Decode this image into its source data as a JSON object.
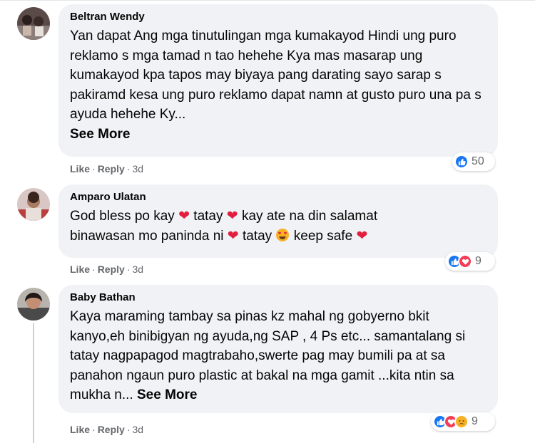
{
  "comments": [
    {
      "author": "Beltran Wendy",
      "text": "Yan dapat Ang mga tinutulingan mga kumakayod Hindi ung puro reklamo s mga tamad n tao hehehe Kya mas masarap ung kumakayod kpa tapos may biyaya pang darating sayo sarap s pakiramd kesa ung puro reklamo dapat namn at gusto puro una pa s ayuda hehehe Ky...",
      "see_more": "See More",
      "like": "Like",
      "reply": "Reply",
      "time": "3d",
      "reactions": [
        "like-icon"
      ],
      "reaction_count": "50"
    },
    {
      "author": "Amparo Ulatan",
      "text_parts": [
        "God bless po kay ",
        "heart",
        " tatay ",
        "heart",
        " kay ate na din salamat binawasan mo paninda ni ",
        "heart",
        " tatay ",
        "heart-eyes",
        " keep safe ",
        "heart"
      ],
      "text_segments": {
        "s1": "God bless po kay",
        "s2": "tatay",
        "s3": "kay ate na din salamat",
        "s4": "binawasan mo paninda ni",
        "s5": "tatay",
        "s6": "keep safe"
      },
      "like": "Like",
      "reply": "Reply",
      "time": "3d",
      "reactions": [
        "like-icon",
        "love-icon"
      ],
      "reaction_count": "9"
    },
    {
      "author": "Baby Bathan",
      "text": "Kaya maraming tambay sa pinas kz mahal ng gobyerno bkit kanyo,eh binibigyan ng ayuda,ng SAP , 4 Ps etc... samantalang si tatay nagpapagod magtrabaho,swerte pag may bumili pa at sa panahon ngaun puro plastic at bakal na mga gamit ...kita ntin sa mukha n...",
      "see_more": "See More",
      "like": "Like",
      "reply": "Reply",
      "time": "3d",
      "reactions": [
        "like-icon",
        "love-icon",
        "sad-icon"
      ],
      "reaction_count": "9"
    }
  ],
  "colors": {
    "bubble": "#f0f2f5",
    "meta": "#65676b",
    "like_blue": "#1877f2",
    "love_red": "#f33e58",
    "sad_yellow": "#f7b125",
    "heart": "#e41e3f"
  }
}
